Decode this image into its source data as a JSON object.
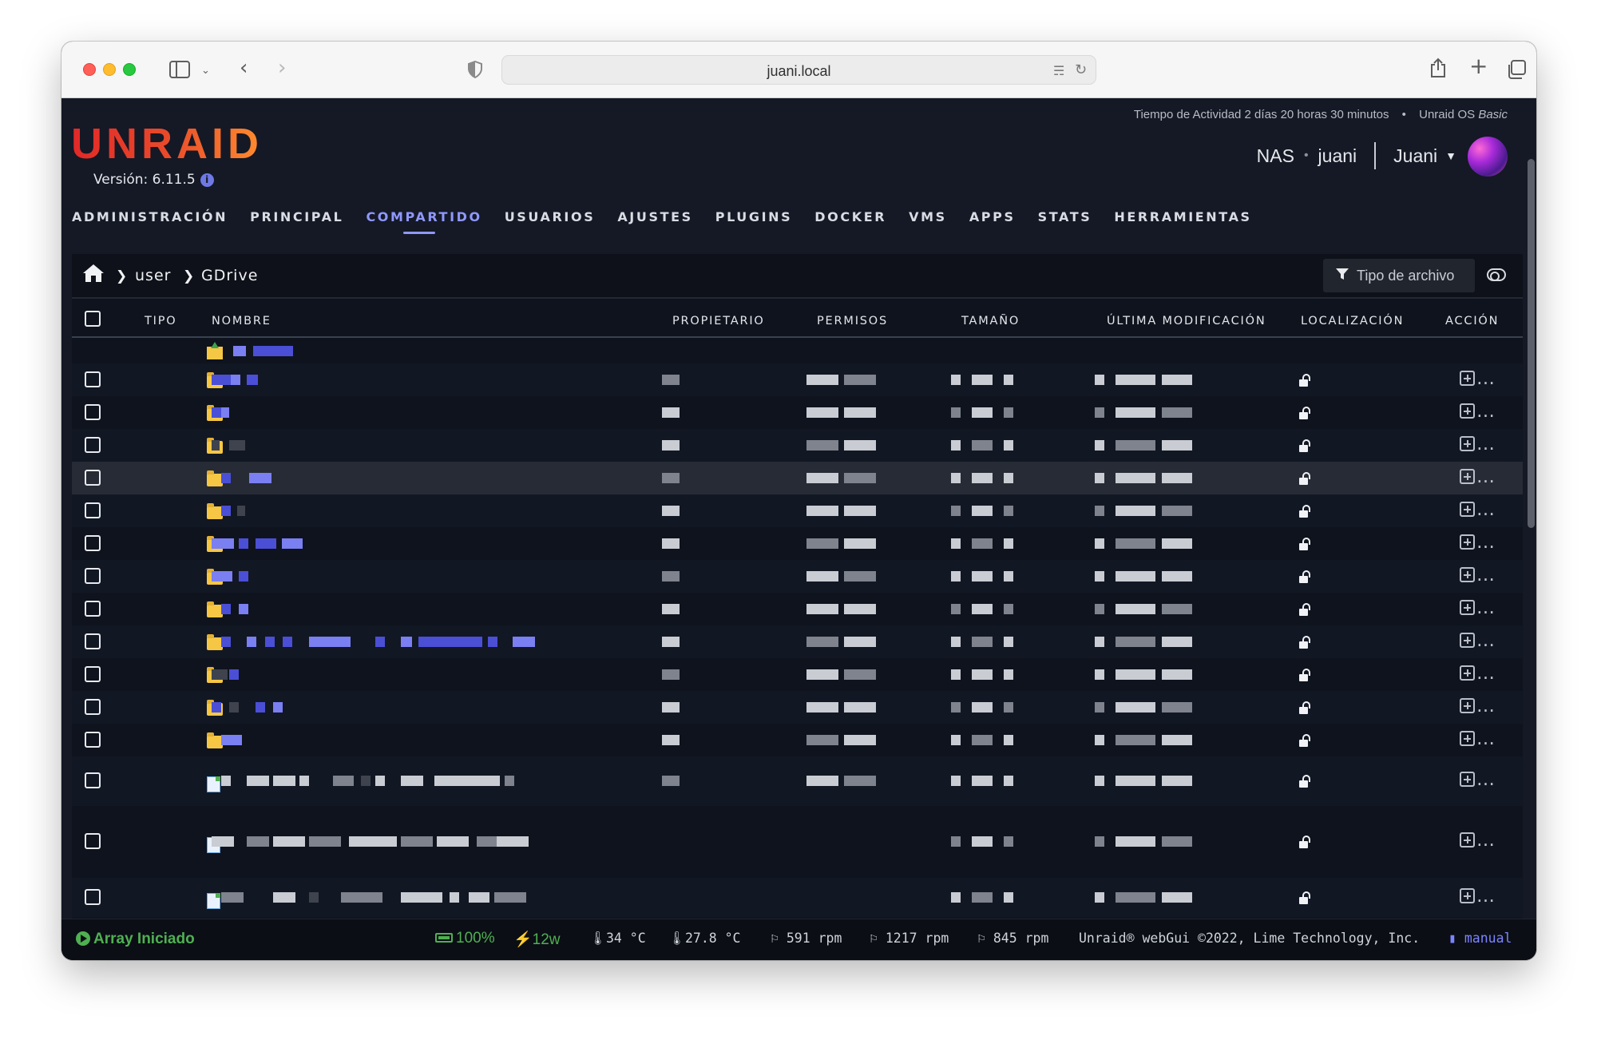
{
  "browser": {
    "url": "juani.local"
  },
  "header": {
    "uptime_prefix": "Tiempo de Actividad 2 días 20 horas 30 minutos",
    "bullet": "•",
    "os_name": "Unraid OS",
    "os_edition": "Basic",
    "logo": "UNRAID",
    "version": "Versión: 6.11.5",
    "server_type": "NAS",
    "server_name": "juani",
    "user": "Juani"
  },
  "nav": {
    "items": [
      "ADMINISTRACIÓN",
      "PRINCIPAL",
      "COMPARTIDO",
      "USUARIOS",
      "AJUSTES",
      "PLUGINS",
      "DOCKER",
      "VMS",
      "APPS",
      "STATS",
      "HERRAMIENTAS"
    ],
    "active": "COMPARTIDO"
  },
  "breadcrumb": {
    "segments": [
      "user",
      "GDrive"
    ]
  },
  "filter": {
    "label": "Tipo de archivo"
  },
  "table": {
    "columns": {
      "tipo": "TIPO",
      "nombre": "NOMBRE",
      "propietario": "PROPIETARIO",
      "permisos": "PERMISOS",
      "tamano": "TAMAÑO",
      "modificacion": "ÚLTIMA MODIFICACIÓN",
      "localizacion": "LOCALIZACIÓN",
      "accion": "ACCIÓN"
    },
    "action_label": "…"
  },
  "footer": {
    "array_status": "Array Iniciado",
    "battery": "100%",
    "power": "12w",
    "temp1": "34 °C",
    "temp2": "27.8 °C",
    "fan1": "591 rpm",
    "fan2": "1217 rpm",
    "fan3": "845 rpm",
    "copyright": "Unraid® webGui ©2022, Lime Technology, Inc.",
    "manual": "manual"
  },
  "colors": {
    "accent": "#8f98ff",
    "logo_start": "#e22828",
    "logo_end": "#ff8c2f",
    "status_green": "#4fb052"
  }
}
